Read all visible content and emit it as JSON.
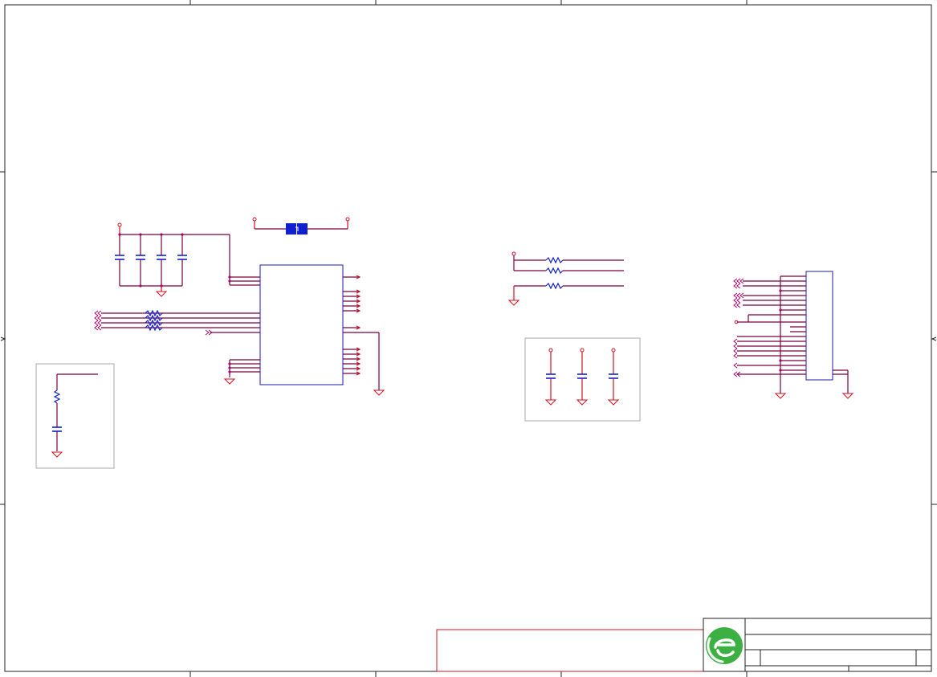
{
  "schematic": {
    "title_block_text": "",
    "logo": "ee-logo-icon",
    "colors": {
      "wire": "#7a0040",
      "power_wire": "#d01020",
      "component": "#1020d0",
      "frame": "#202020",
      "logo_green": "#3cb043"
    }
  }
}
